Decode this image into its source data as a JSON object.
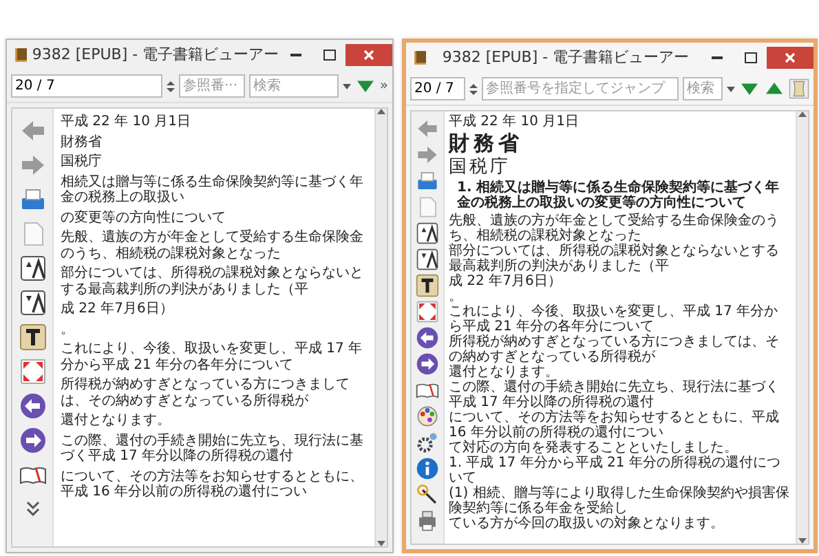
{
  "windows": [
    {
      "kind": "compact",
      "title": "9382 [EPUB] - 電子書籍ビューアー",
      "toolbar": {
        "page_field": "20 / 7",
        "jump_placeholder": "参照番···",
        "search_placeholder": "検索",
        "overflow": "»"
      },
      "document": [
        {
          "kind": "body",
          "text": "平成 22 年 10 月1日"
        },
        {
          "kind": "body",
          "text": "財務省"
        },
        {
          "kind": "body",
          "text": "国税庁"
        },
        {
          "kind": "body",
          "text": "相続又は贈与等に係る生命保険契約等に基づく年金の税務上の取扱い"
        },
        {
          "kind": "body",
          "text": "の変更等の方向性について"
        },
        {
          "kind": "body",
          "text": "先般、遺族の方が年金として受給する生命保険金のうち、相続税の課税対象となった"
        },
        {
          "kind": "body",
          "text": "部分については、所得税の課税対象とならないとする最高裁判所の判決がありました（平"
        },
        {
          "kind": "body",
          "text": "成 22 年7月6日）"
        },
        {
          "kind": "body",
          "text": "。"
        },
        {
          "kind": "body",
          "text": "これにより、今後、取扱いを変更し、平成 17 年分から平成 21 年分の各年分について"
        },
        {
          "kind": "body",
          "text": "所得税が納めすぎとなっている方につきましては、その納めすぎとなっている所得税が"
        },
        {
          "kind": "body",
          "text": "還付となります。"
        },
        {
          "kind": "body",
          "text": "この際、還付の手続き開始に先立ち、現行法に基づく平成 17 年分以降の所得税の還付"
        },
        {
          "kind": "body",
          "text": "について、その方法等をお知らせするとともに、平成 16 年分以前の所得税の還付につい"
        }
      ]
    },
    {
      "kind": "full",
      "title": "9382 [EPUB] - 電子書籍ビューアー",
      "toolbar": {
        "page_field": "20 / 7",
        "jump_placeholder": "参照番号を指定してジャンプ",
        "search_placeholder": "検索"
      },
      "document": [
        {
          "kind": "date",
          "text": "平成 22 年 10 月1日"
        },
        {
          "kind": "heading1",
          "text": "財務省"
        },
        {
          "kind": "heading2",
          "text": "国税庁"
        },
        {
          "kind": "numbered",
          "text": "1. 相続又は贈与等に係る生命保険契約等に基づく年金の税務上の取扱いの変更等の方向性について"
        },
        {
          "kind": "body",
          "text": "先般、遺族の方が年金として受給する生命保険金のうち、相続税の課税対象となった"
        },
        {
          "kind": "body",
          "text": "部分については、所得税の課税対象とならないとする最高裁判所の判決がありました（平"
        },
        {
          "kind": "body",
          "text": "成 22 年7月6日）"
        },
        {
          "kind": "body",
          "text": "。"
        },
        {
          "kind": "body",
          "text": "これにより、今後、取扱いを変更し、平成 17 年分から平成 21 年分の各年分について"
        },
        {
          "kind": "body",
          "text": "所得税が納めすぎとなっている方につきましては、その納めすぎとなっている所得税が"
        },
        {
          "kind": "body",
          "text": "還付となります。"
        },
        {
          "kind": "body",
          "text": "この際、還付の手続き開始に先立ち、現行法に基づく平成 17 年分以降の所得税の還付"
        },
        {
          "kind": "body",
          "text": "について、その方法等をお知らせするとともに、平成 16 年分以前の所得税の還付につい"
        },
        {
          "kind": "body",
          "text": "て対応の方向を発表することといたしました。"
        },
        {
          "kind": "body",
          "text": "1. 平成 17 年分から平成 21 年分の所得税の還付について"
        },
        {
          "kind": "body",
          "text": "(1) 相続、贈与等により取得した生命保険契約や損害保険契約等に係る年金を受給し"
        },
        {
          "kind": "body",
          "text": "ている方が今回の取扱いの対象となります。"
        }
      ]
    }
  ]
}
